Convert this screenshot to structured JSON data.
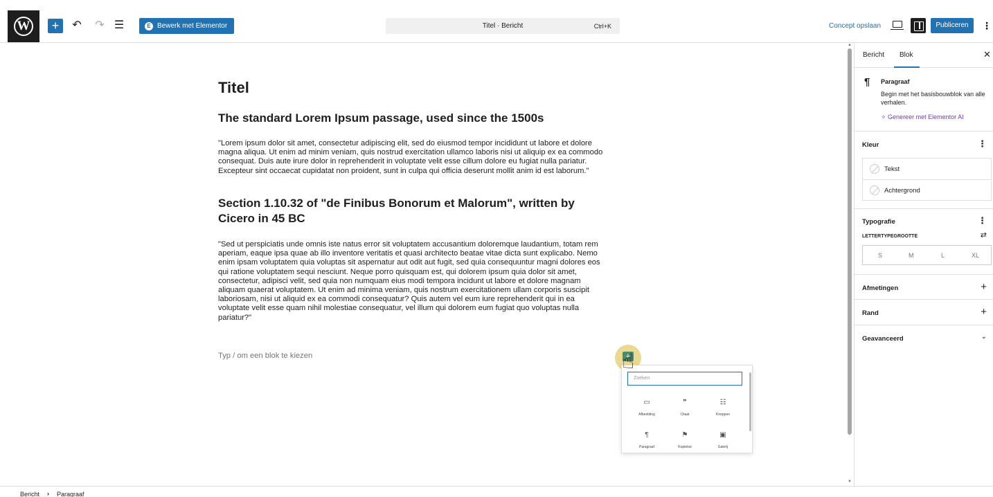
{
  "toolbar": {
    "wp_logo": "W",
    "add_icon": "plus-icon",
    "undo_icon": "undo-icon",
    "redo_icon": "redo-icon",
    "list_view_icon": "list-view-icon",
    "elementor_label": "Bewerk met Elementor",
    "command_title": "Titel · Bericht",
    "command_shortcut": "Ctrl+K",
    "save_draft": "Concept opslaan",
    "publish": "Publiceren",
    "accent": "#2271b1"
  },
  "post": {
    "title": "Titel",
    "h2_1": "The standard Lorem Ipsum passage, used since the 1500s",
    "p1_lines": [
      "\"Lorem ipsum dolor sit amet, consectetur adipiscing elit, sed do eiusmod tempor incididunt ut labore et dolore",
      "magna aliqua. Ut enim ad minim veniam, quis nostrud exercitation ullamco laboris nisi ut aliquip ex ea commodo",
      "consequat. Duis aute irure dolor in reprehenderit in voluptate velit esse cillum dolore eu fugiat nulla pariatur.",
      "Excepteur sint occaecat cupidatat non proident, sunt in culpa qui officia deserunt mollit anim id est laborum.\""
    ],
    "h2_2_line1": "Section 1.10.32 of \"de Finibus Bonorum et Malorum\", written by",
    "h2_2_line2": "Cicero in 45 BC",
    "p2_lines": [
      "\"Sed ut perspiciatis unde omnis iste natus error sit voluptatem accusantium doloremque laudantium, totam rem",
      "aperiam, eaque ipsa quae ab illo inventore veritatis et quasi architecto beatae vitae dicta sunt explicabo. Nemo",
      "enim ipsam voluptatem quia voluptas sit aspernatur aut odit aut fugit, sed quia consequuntur magni dolores eos",
      "qui ratione voluptatem sequi nesciunt. Neque porro quisquam est, qui dolorem ipsum quia dolor sit amet,",
      "consectetur, adipisci velit, sed quia non numquam eius modi tempora incidunt ut labore et dolore magnam",
      "aliquam quaerat voluptatem. Ut enim ad minima veniam, quis nostrum exercitationem ullam corporis suscipit",
      "laboriosam, nisi ut aliquid ex ea commodi consequatur? Quis autem vel eum iure reprehenderit qui in ea",
      "voluptate velit esse quam nihil molestiae consequatur, vel illum qui dolorem eum fugiat quo voluptas nulla",
      "pariatur?\""
    ],
    "placeholder": "Typ / om een blok te kiezen"
  },
  "inserter": {
    "search_placeholder": "Zoeken",
    "items": [
      {
        "label": "Afbeelding",
        "icon": "image-icon"
      },
      {
        "label": "Citaat",
        "icon": "quote-icon"
      },
      {
        "label": "Knoppen",
        "icon": "buttons-icon"
      },
      {
        "label": "Paragraaf",
        "icon": "paragraph-icon"
      },
      {
        "label": "Koptekst",
        "icon": "heading-icon"
      },
      {
        "label": "Galerij",
        "icon": "gallery-icon"
      }
    ]
  },
  "sidebar": {
    "tab_post": "Bericht",
    "tab_block": "Blok",
    "block_name": "Paragraaf",
    "block_desc": "Begin met het basisbouwblok van alle verhalen.",
    "ai_link": "Genereer met Elementor AI",
    "color_heading": "Kleur",
    "color_text": "Tekst",
    "color_background": "Achtergrond",
    "typography_heading": "Typografie",
    "font_size_label": "LETTERTYPEGROOTTE",
    "font_sizes": [
      "S",
      "M",
      "L",
      "XL"
    ],
    "dimensions_heading": "Afmetingen",
    "border_heading": "Rand",
    "advanced_heading": "Geavanceerd",
    "ai_color": "#7b2fc9"
  },
  "footer": {
    "crumb_post": "Bericht",
    "crumb_block": "Paragraaf"
  }
}
